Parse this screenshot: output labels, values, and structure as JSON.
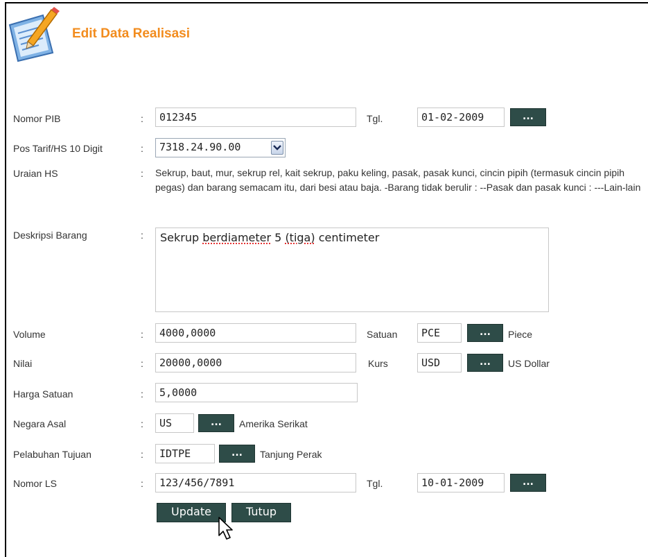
{
  "title": "Edit Data Realisasi",
  "fields": {
    "nomor_pib": {
      "label": "Nomor PIB",
      "value": "012345",
      "tgl_label": "Tgl.",
      "tgl_value": "01-02-2009"
    },
    "pos_tarif": {
      "label": "Pos Tarif/HS 10 Digit",
      "value": "7318.24.90.00"
    },
    "uraian_hs": {
      "label": "Uraian HS",
      "value": "Sekrup, baut, mur, sekrup rel, kait sekrup, paku keling, pasak, pasak kunci, cincin pipih (termasuk cincin pipih pegas) dan barang semacam itu, dari besi atau baja. -Barang tidak berulir : --Pasak dan pasak kunci : ---Lain-lain"
    },
    "deskripsi": {
      "label": "Deskripsi Barang",
      "word1": "Sekrup",
      "word2": "berdiameter",
      "word3": "5",
      "word4": "(tiga)",
      "word5": "centimeter"
    },
    "volume": {
      "label": "Volume",
      "value": "4000,0000",
      "satuan_label": "Satuan",
      "satuan_code": "PCE",
      "satuan_name": "Piece"
    },
    "nilai": {
      "label": "Nilai",
      "value": "20000,0000",
      "kurs_label": "Kurs",
      "kurs_code": "USD",
      "kurs_name": "US Dollar"
    },
    "harga_satuan": {
      "label": "Harga Satuan",
      "value": "5,0000"
    },
    "negara_asal": {
      "label": "Negara Asal",
      "code": "US",
      "name": "Amerika Serikat"
    },
    "pelabuhan": {
      "label": "Pelabuhan Tujuan",
      "code": "IDTPE",
      "name": "Tanjung Perak"
    },
    "nomor_ls": {
      "label": "Nomor LS",
      "value": "123/456/7891",
      "tgl_label": "Tgl.",
      "tgl_value": "10-01-2009"
    }
  },
  "colon": ":",
  "lookup_label": "...",
  "buttons": {
    "update": "Update",
    "tutup": "Tutup"
  }
}
